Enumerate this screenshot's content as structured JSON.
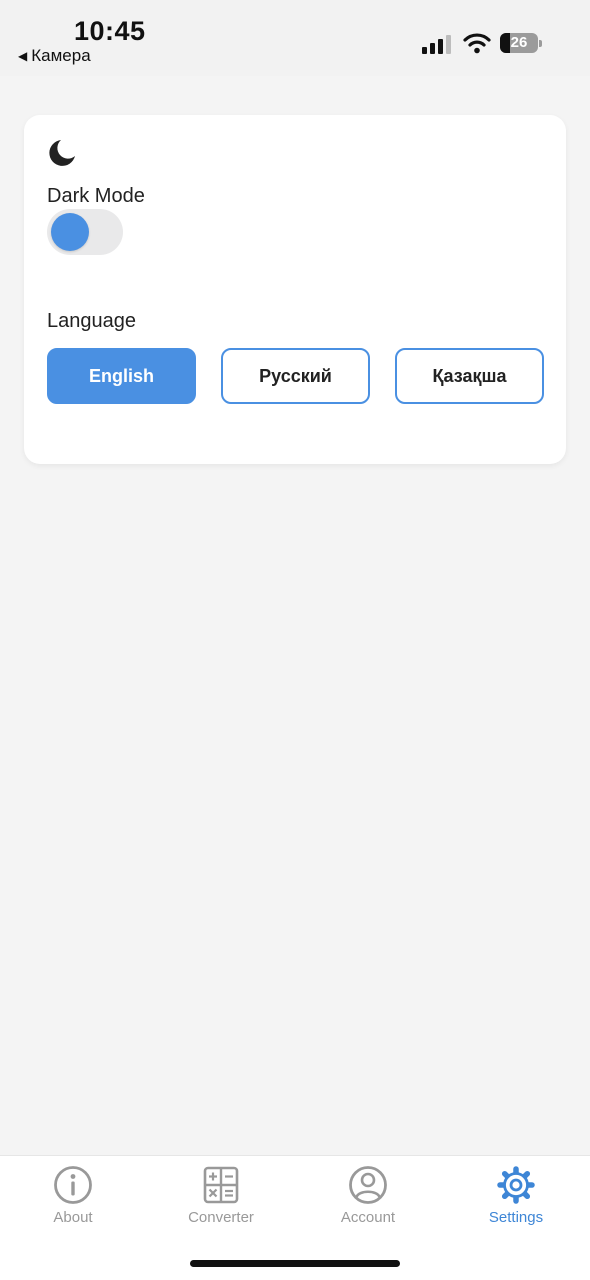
{
  "status_bar": {
    "time": "10:45",
    "back_app": "Камера",
    "battery_percent": "26",
    "battery_level": 0.26,
    "icons": [
      "cellular-signal-icon",
      "wifi-icon",
      "battery-icon"
    ]
  },
  "settings": {
    "dark_mode": {
      "icon": "moon-icon",
      "label": "Dark Mode",
      "enabled": false
    },
    "language": {
      "label": "Language",
      "selected": "English",
      "options": [
        "English",
        "Русский",
        "Қазақша"
      ]
    }
  },
  "tab_bar": {
    "tabs": [
      {
        "label": "About",
        "icon": "info-icon"
      },
      {
        "label": "Converter",
        "icon": "calculator-icon"
      },
      {
        "label": "Account",
        "icon": "user-icon"
      },
      {
        "label": "Settings",
        "icon": "gear-icon"
      }
    ],
    "active": "Settings"
  },
  "colors": {
    "accent": "#4a90e2",
    "tab_active": "#3e86d6",
    "tab_inactive": "#999999",
    "background": "#f4f4f4"
  }
}
